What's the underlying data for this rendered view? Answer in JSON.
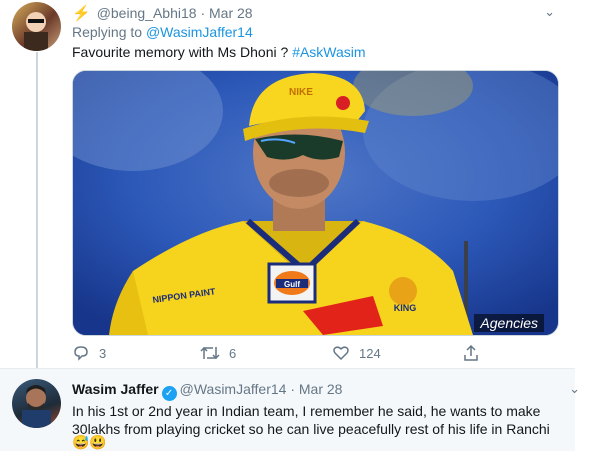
{
  "tweet1": {
    "handle": "@being_Abhi18",
    "separator": "·",
    "date": "Mar 28",
    "replying_prefix": "Replying to",
    "replying_to": "@WasimJaffer14",
    "text": "Favourite memory with Ms Dhoni ? ",
    "hashtag": "#AskWasim",
    "media": {
      "credit": "Agencies",
      "cap_logo_text": "NIKE",
      "jersey_text_left": "NIPPON PAINT",
      "jersey_text_right": "KING",
      "sponsor": "Gulf"
    },
    "actions": {
      "reply_count": "3",
      "retweet_count": "6",
      "like_count": "124",
      "share_label": ""
    }
  },
  "tweet2": {
    "name": "Wasim Jaffer",
    "verified_mark": "✓",
    "handle": "@WasimJaffer14",
    "separator": "·",
    "date": "Mar 28",
    "text": "In his 1st or 2nd year in Indian team, I remember he said, he wants to make 30lakhs from playing cricket so he can live peacefully rest of his life in Ranchi",
    "emoji": "😅😃"
  },
  "icons": {
    "bolt": "⚡",
    "caret": "⌄"
  }
}
